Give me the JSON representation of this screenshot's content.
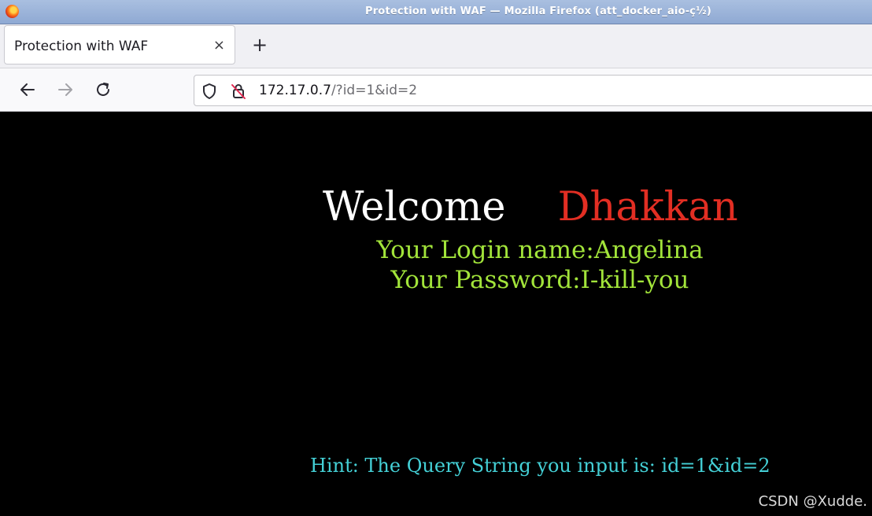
{
  "window": {
    "title": "Protection with WAF — Mozilla Firefox (att_docker_aio-ç½)"
  },
  "tabs": [
    {
      "label": "Protection with WAF",
      "close_glyph": "×",
      "active": true
    }
  ],
  "new_tab_glyph": "+",
  "nav": {
    "back_glyph": "←",
    "forward_glyph": "→",
    "reload_glyph": "↻",
    "url_host": "172.17.0.7",
    "url_rest": "/?id=1&id=2"
  },
  "page": {
    "welcome": "Welcome",
    "name": "Dhakkan",
    "login_line": "Your Login name:Angelina",
    "password_line": "Your Password:I-kill-you",
    "hint_line": "Hint: The Query String you input is: id=1&id=2"
  },
  "watermark": "CSDN @Xudde.",
  "colors": {
    "page_background": "#000000",
    "welcome_text": "#ffffff",
    "name_text": "#e22e23",
    "credentials_text": "#a2e43a",
    "hint_text": "#44d0d6"
  }
}
